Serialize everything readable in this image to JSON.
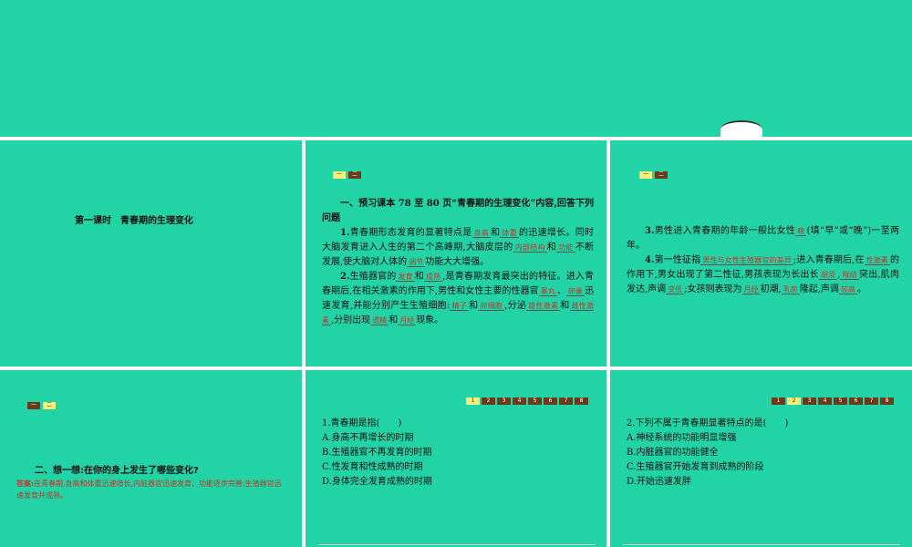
{
  "tabs": {
    "one": "一",
    "two": "二"
  },
  "pager": [
    "1",
    "2",
    "3",
    "4",
    "5",
    "6",
    "7",
    "8"
  ],
  "slide1": {
    "title": "第一课时　青春期的生理变化"
  },
  "slide2": {
    "heading": "一、预习课本 78 至 80 页“青春期的生理变化”内容,回答下列问题",
    "p1": {
      "num": "1.",
      "t1": "青春期形态发育的显著特点是",
      "a1": "身高",
      "t2": "和",
      "a2": "体重",
      "t3": "的迅速增长。同时大脑发育进入人生的第二个高峰期,大脑皮层的",
      "a3": "内部结构",
      "t4": "和",
      "a4": "功能",
      "t5": "不断发展,使大脑对人体的",
      "a5": "调节",
      "t6": "功能大大增强。"
    },
    "p2": {
      "num": "2.",
      "t1": "生殖器官的",
      "a1": "发育",
      "t2": "和",
      "a2": "成熟",
      "t3": ",是青春期发育最突出的特征。进入青春期后,在相关激素的作用下,男性和女性主要的性器官",
      "a3": "睾丸",
      "t4": "、",
      "a4": "卵巢",
      "t5": "迅速发育,并能分别产生生殖细胞:",
      "a5": "精子",
      "t6": "和",
      "a6": "卵细胞",
      "t7": ",分泌",
      "a7": "雄性激素",
      "t8": "和",
      "a8": "雌性激素",
      "t9": ",分别出现",
      "a9": "遗精",
      "t10": "和",
      "a10": "月经",
      "t11": "现象。"
    }
  },
  "slide3": {
    "p3": {
      "num": "3.",
      "t1": "男性进入青春期的年龄一般比女性",
      "a1": "晚",
      "t2": "(填“早”或“晚”)一至两年。"
    },
    "p4": {
      "num": "4.",
      "t1": "第一性征指",
      "a1": "男性与女性生殖器官的差异",
      "t2": ";进入青春期后,在",
      "a2": "性激素",
      "t3": "的作用下,男女出现了第二性征,男孩表现为长出长",
      "a3": "胡须",
      "t4": ",",
      "a4": "喉结",
      "t5": "突出,肌肉发达,声调",
      "a5": "变低",
      "t6": ";女孩则表现为",
      "a6": "月经",
      "t7": "初潮,",
      "a7": "乳房",
      "t8": "隆起,声调",
      "a8": "较高",
      "t9": "。"
    }
  },
  "slide4": {
    "heading": "二、想一想:在你的身上发生了哪些变化?",
    "answer_label": "答案:",
    "answer_text": "在青春期,身高和体重迅速增长,内脏器官迅速发育、功能逐步完善,生殖器官迅速发育并成熟。"
  },
  "slide5": {
    "question": "1.青春期是指(　　)",
    "options": [
      "A.身高不再增长的时期",
      "B.生殖器官不再发育的时期",
      "C.性发育和性成熟的时期",
      "D.身体完全发育成熟的时期"
    ]
  },
  "slide6": {
    "question": "2.下列不属于青春期显著特点的是(　　)",
    "options": [
      "A.神经系统的功能明显增强",
      "B.内脏器官的功能健全",
      "C.生殖器官开始发育到成熟的阶段",
      "D.开始迅速发胖"
    ]
  },
  "colors": {
    "background": "#22d3a6",
    "answer": "#c0392b",
    "tab": "#6b3a1a",
    "tab_active": "#f6f07a"
  }
}
